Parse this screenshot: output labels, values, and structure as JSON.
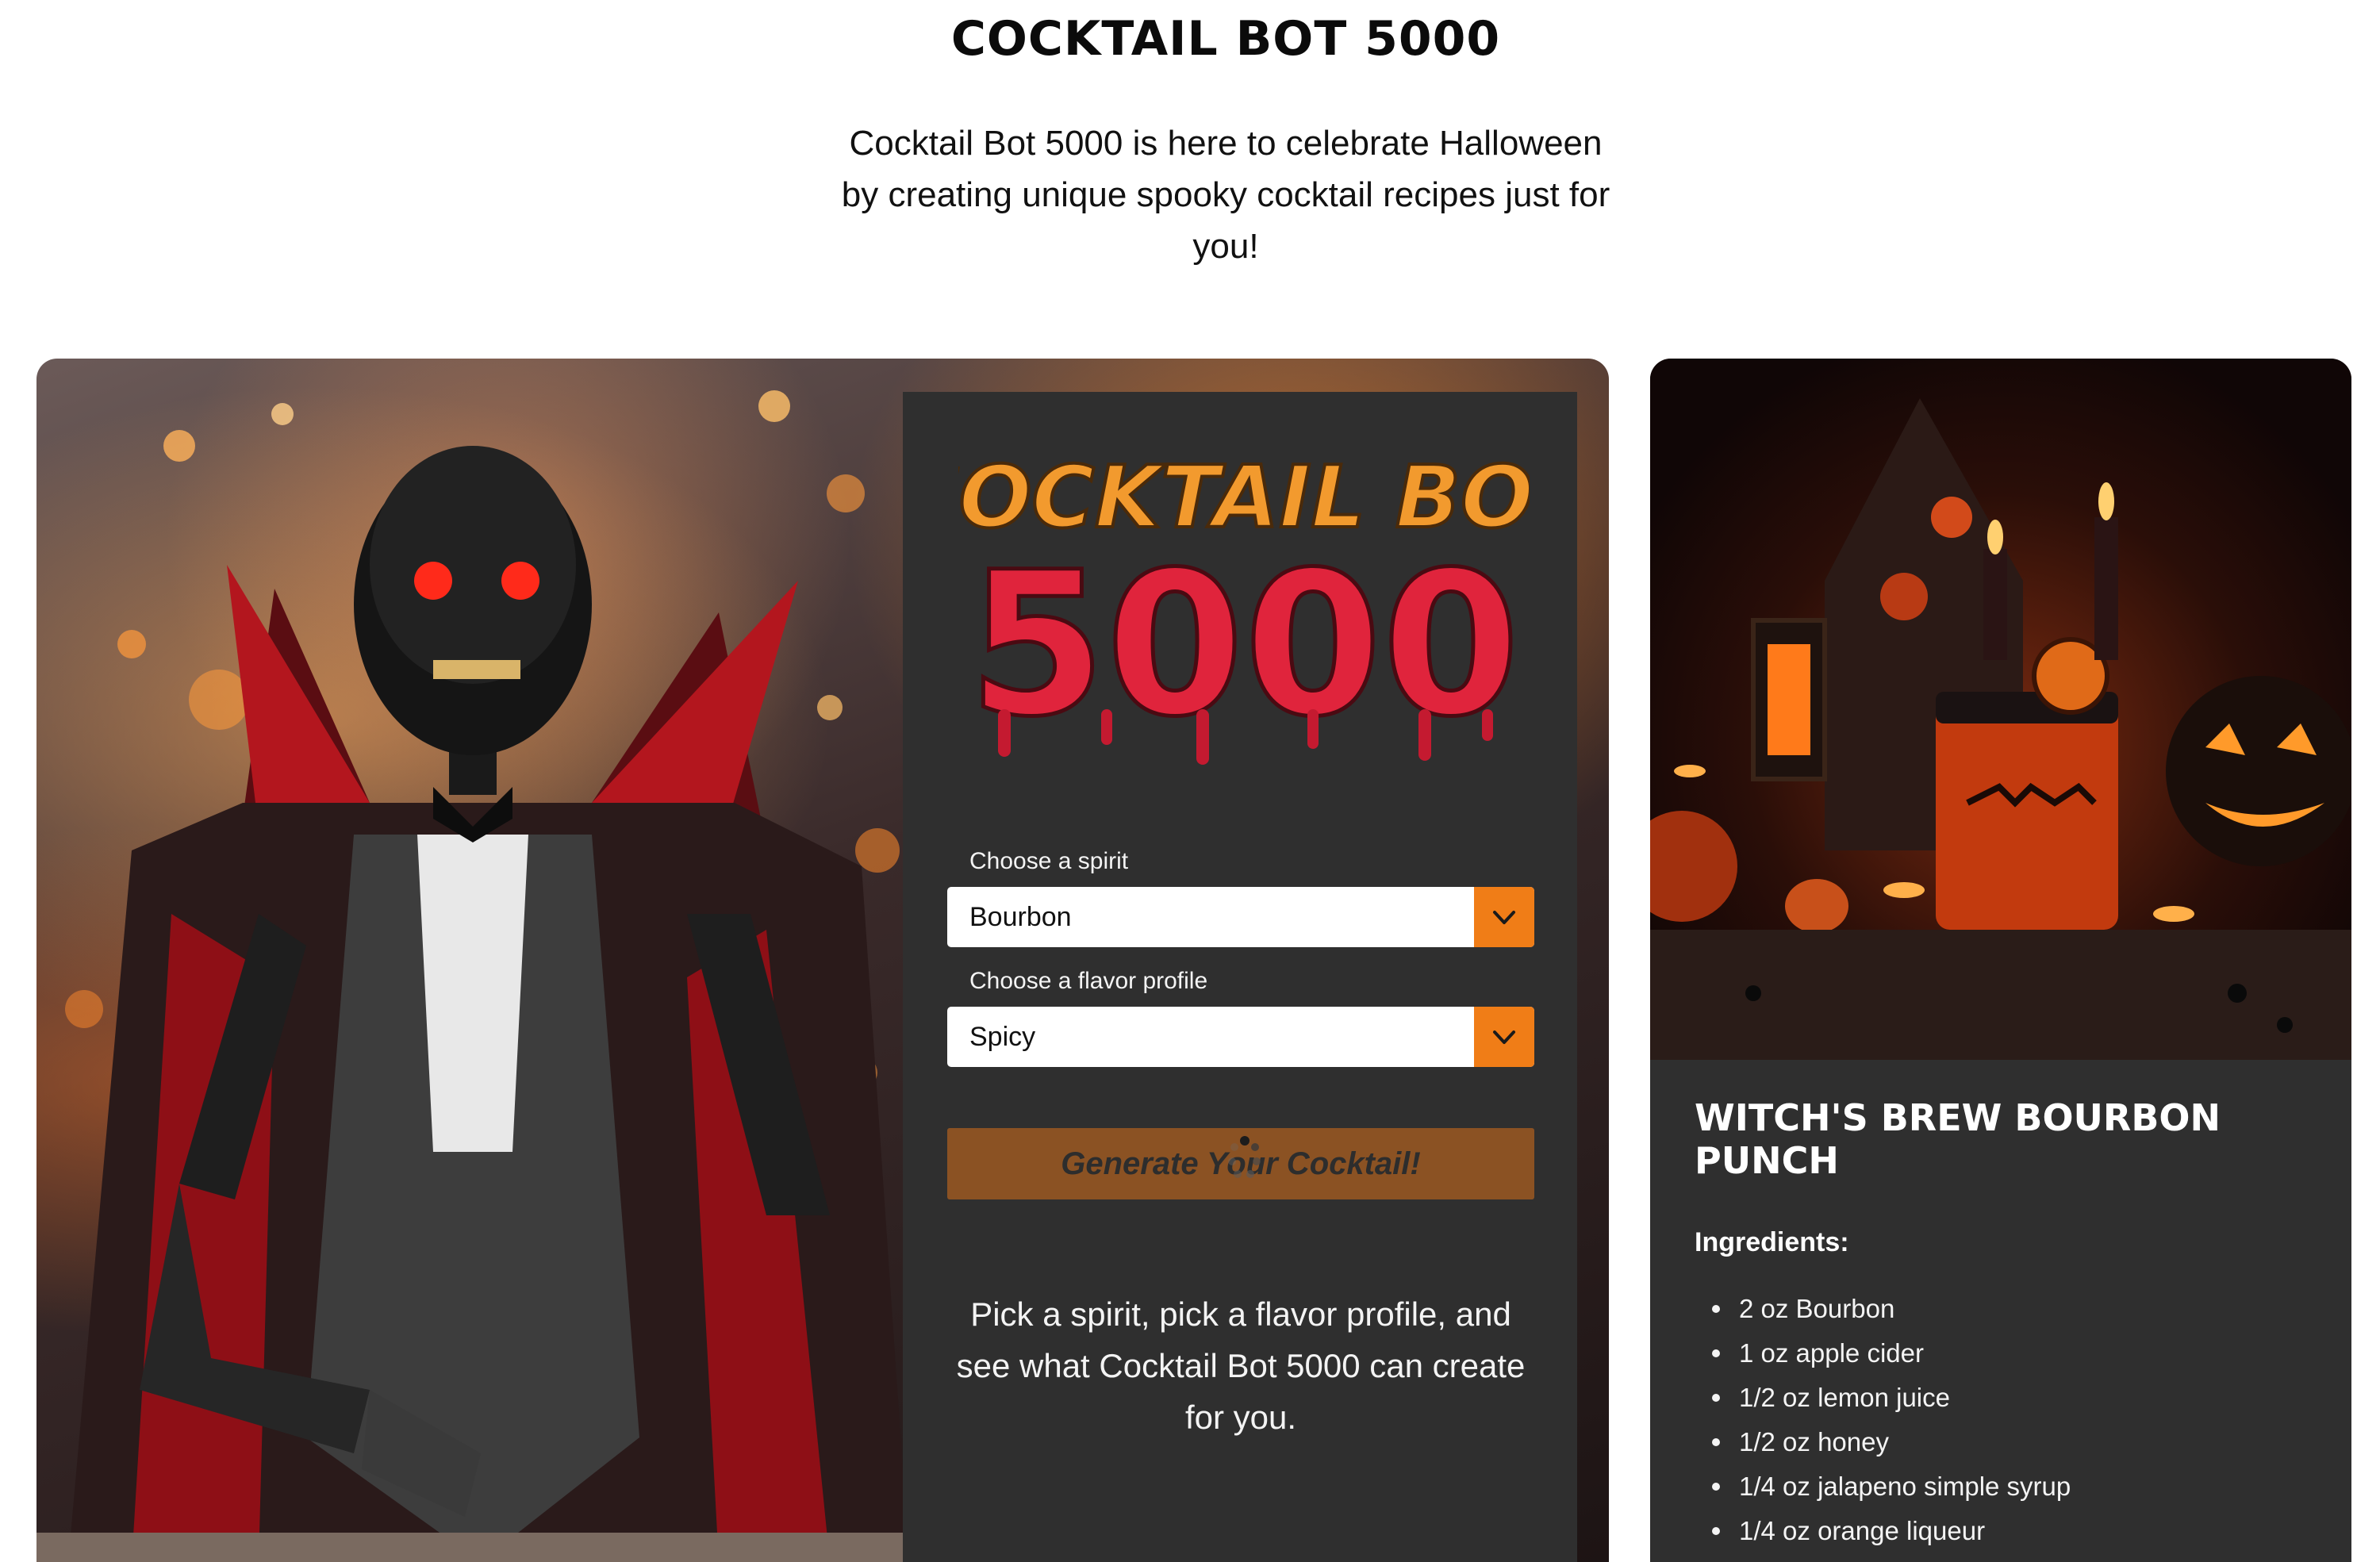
{
  "page": {
    "title": "COCKTAIL BOT 5000",
    "intro": "Cocktail Bot 5000 is here to celebrate Halloween by creating unique spooky cocktail recipes just for you!"
  },
  "logo": {
    "line1": "COCKTAIL BOT",
    "line2": "5000"
  },
  "form": {
    "spirit_label": "Choose a spirit",
    "spirit_value": "Bourbon",
    "flavor_label": "Choose a flavor profile",
    "flavor_value": "Spicy",
    "generate_label": "Generate Your Cocktail!",
    "hint": "Pick a spirit, pick a flavor profile, and see what Cocktail Bot 5000 can create for you."
  },
  "recipe": {
    "title": "WITCH'S BREW BOURBON PUNCH",
    "ingredients_heading": "Ingredients:",
    "ingredients": [
      "2 oz Bourbon",
      "1 oz apple cider",
      "1/2 oz lemon juice",
      "1/2 oz honey",
      "1/4 oz jalapeno simple syrup",
      "1/4 oz orange liqueur"
    ]
  },
  "colors": {
    "accent_orange": "#f07d17",
    "button_brown": "#8b5223",
    "panel_dark": "#2f2f2f",
    "logo_orange": "#f29a2e",
    "logo_red": "#e0243c"
  },
  "icons": {
    "select_arrow": "chevron-down-icon",
    "loading": "spinner-icon"
  }
}
